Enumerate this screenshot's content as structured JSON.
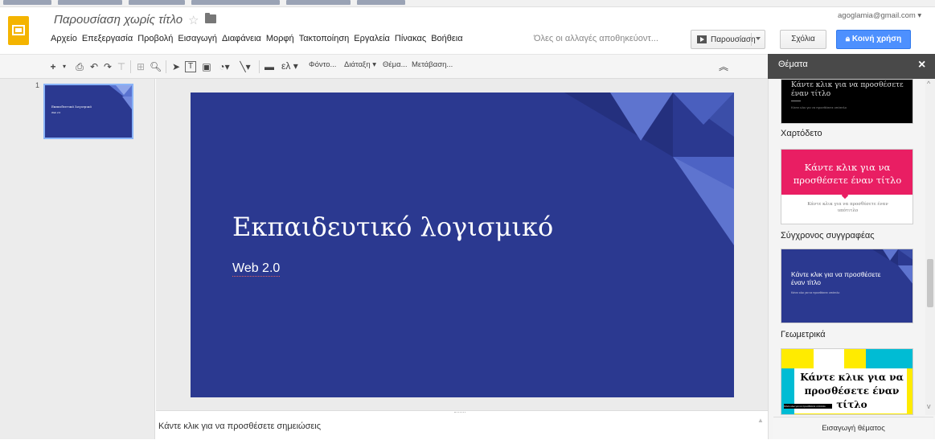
{
  "header": {
    "doc_title": "Παρουσίαση χωρίς τίτλο",
    "account_email": "agoglamia@gmail.com",
    "save_status": "Όλες οι αλλαγές αποθηκεύοντ...",
    "present_label": "Παρουσίαση",
    "comments_label": "Σχόλια",
    "share_label": "Κοινή χρήση"
  },
  "menu": [
    "Αρχείο",
    "Επεξεργασία",
    "Προβολή",
    "Εισαγωγή",
    "Διαφάνεια",
    "Μορφή",
    "Τακτοποίηση",
    "Εργαλεία",
    "Πίνακας",
    "Βοήθεια"
  ],
  "toolbar": {
    "language": "ελ",
    "background": "Φόντο...",
    "layout": "Διάταξη",
    "theme": "Θέμα...",
    "transition": "Μετάβαση..."
  },
  "filmstrip": {
    "slide_number": "1",
    "thumb_title": "Εκπαιδευτικό λογισμικό",
    "thumb_subtitle": "Web 2.0"
  },
  "slide": {
    "title": "Εκπαιδευτικό λογισμικό",
    "subtitle": "Web 2.0"
  },
  "notes": {
    "placeholder": "Κάντε κλικ για να προσθέσετε σημειώσεις"
  },
  "themes_panel": {
    "title": "Θέματα",
    "close": "×",
    "import_button": "Εισαγωγή θέματος",
    "themes": [
      {
        "name": "",
        "preview_title": "Κάντε κλικ για να προσθέσετε έναν τίτλο",
        "preview_subtitle": "Κάντε κλικ για να προσθέσετε υπότιτλο"
      },
      {
        "name": "Χαρτόδετο",
        "preview_title": "Κάντε κλικ για να προσθέσετε έναν τίτλο",
        "preview_subtitle": "Κάντε κλικ για να προσθέσετε έναν υπότιτλο"
      },
      {
        "name": "Σύγχρονος συγγραφέας",
        "preview_title": "Κάντε κλικ για να προσθέσετε έναν τίτλο",
        "preview_subtitle": "Κάντε κλικ για να προσθέσετε υπότιτλο"
      },
      {
        "name": "Γεωμετρικά",
        "preview_title": "Κάντε κλικ για να προσθέσετε έναν τίτλο",
        "preview_subtitle": "Κάντε κλικ για να προσθέσετε υπότιτλο"
      }
    ]
  },
  "colors": {
    "slide_bg": "#2b3990",
    "share_btn": "#4d90fe",
    "app_logo": "#f4b400",
    "binder_pink": "#e91e63",
    "geometric_yellow": "#ffeb00",
    "geometric_cyan": "#00bcd4"
  }
}
